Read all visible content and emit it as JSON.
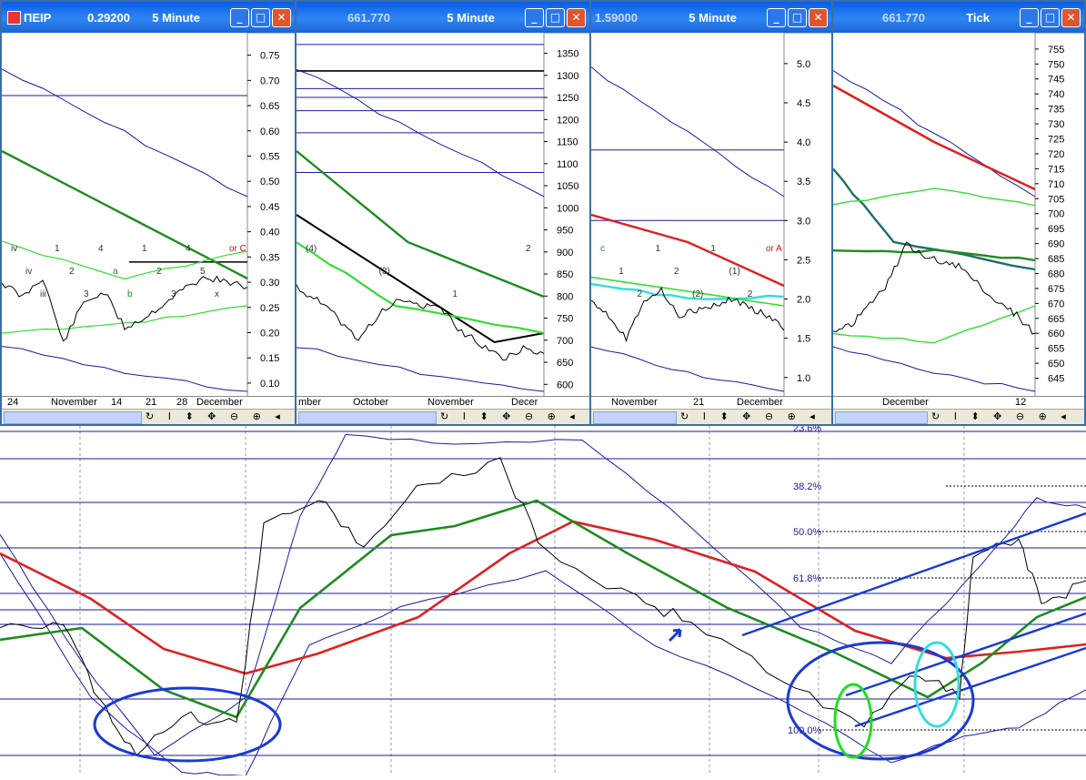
{
  "windows": [
    {
      "id": "w1",
      "symbol": "ΠΕΙΡ",
      "value": "0.29200",
      "interval": "5 Minute",
      "dates": [
        "24",
        "November",
        "14",
        "21",
        "28",
        "December"
      ],
      "axis": [
        "0.75",
        "0.70",
        "0.65",
        "0.60",
        "0.55",
        "0.50",
        "0.45",
        "0.40",
        "0.35",
        "0.30",
        "0.25",
        "0.20",
        "0.15",
        "0.10"
      ],
      "labels": [
        "iv",
        "iv",
        "iii",
        "1",
        "2",
        "3",
        "4",
        "a",
        "b",
        "1",
        "2",
        "3",
        "4",
        "5",
        "x",
        "or C"
      ]
    },
    {
      "id": "w2",
      "symbol": "",
      "value": "661.770",
      "interval": "5 Minute",
      "dates": [
        "mber",
        "October",
        "November",
        "Decer"
      ],
      "axis": [
        "1350",
        "1300",
        "1250",
        "1200",
        "1150",
        "1100",
        "1050",
        "1000",
        "950",
        "900",
        "850",
        "800",
        "750",
        "700",
        "650",
        "600"
      ],
      "labels": [
        "(4)",
        "(3)",
        "1",
        "2"
      ]
    },
    {
      "id": "w3",
      "symbol": "",
      "value": "1.59000",
      "interval": "5 Minute",
      "dates": [
        "November",
        "21",
        "December"
      ],
      "axis": [
        "5.0",
        "4.5",
        "4.0",
        "3.5",
        "3.0",
        "2.5",
        "2.0",
        "1.5",
        "1.0"
      ],
      "labels": [
        "c",
        "1",
        "2",
        "1",
        "2",
        "(2)",
        "1",
        "(1)",
        "2",
        "or A"
      ]
    },
    {
      "id": "w4",
      "symbol": "",
      "value": "661.770",
      "interval": "Tick",
      "dates": [
        "December",
        "12"
      ],
      "axis": [
        "755",
        "750",
        "745",
        "740",
        "735",
        "730",
        "725",
        "720",
        "715",
        "710",
        "705",
        "700",
        "695",
        "690",
        "685",
        "680",
        "675",
        "670",
        "665",
        "660",
        "655",
        "650",
        "645"
      ],
      "labels": []
    }
  ],
  "fib": [
    {
      "label": "23.6%"
    },
    {
      "label": "38.2%"
    },
    {
      "label": "50.0%"
    },
    {
      "label": "61.8%"
    },
    {
      "label": "100.0%"
    }
  ],
  "scroll_tools": "↻ I ⬍ ✥ ⊖ ⊕ ◂ ▸ ▤",
  "chart_data": [
    {
      "type": "line",
      "title": "ΠΕΙΡ",
      "interval": "5 Minute",
      "ylim": [
        0.08,
        0.78
      ],
      "x": [
        "24",
        "November",
        "14",
        "21",
        "28",
        "December"
      ],
      "series": [
        {
          "values": [
            0.3,
            0.27,
            0.31,
            0.18,
            0.26,
            0.28,
            0.21,
            0.23,
            0.26,
            0.29,
            0.31,
            0.3,
            0.29
          ]
        }
      ]
    },
    {
      "type": "line",
      "value": "661.770",
      "interval": "5 Minute",
      "ylim": [
        580,
        1380
      ],
      "x": [
        "October",
        "November",
        "December"
      ],
      "series": [
        {
          "values": [
            820,
            790,
            750,
            700,
            760,
            790,
            780,
            770,
            720,
            690,
            660,
            680,
            670
          ]
        }
      ]
    },
    {
      "type": "line",
      "value": "1.59000",
      "interval": "5 Minute",
      "ylim": [
        0.8,
        5.3
      ],
      "x": [
        "November",
        "21",
        "December"
      ],
      "series": [
        {
          "values": [
            2.0,
            1.8,
            1.5,
            2.0,
            2.1,
            1.8,
            1.85,
            1.9,
            2.0,
            1.9,
            1.8,
            1.6
          ]
        }
      ]
    },
    {
      "type": "line",
      "value": "661.770",
      "interval": "Tick",
      "ylim": [
        640,
        758
      ],
      "x": [
        "December",
        "12"
      ],
      "series": [
        {
          "values": [
            660,
            663,
            670,
            677,
            690,
            685,
            684,
            682,
            676,
            670,
            666,
            660
          ]
        }
      ]
    }
  ]
}
